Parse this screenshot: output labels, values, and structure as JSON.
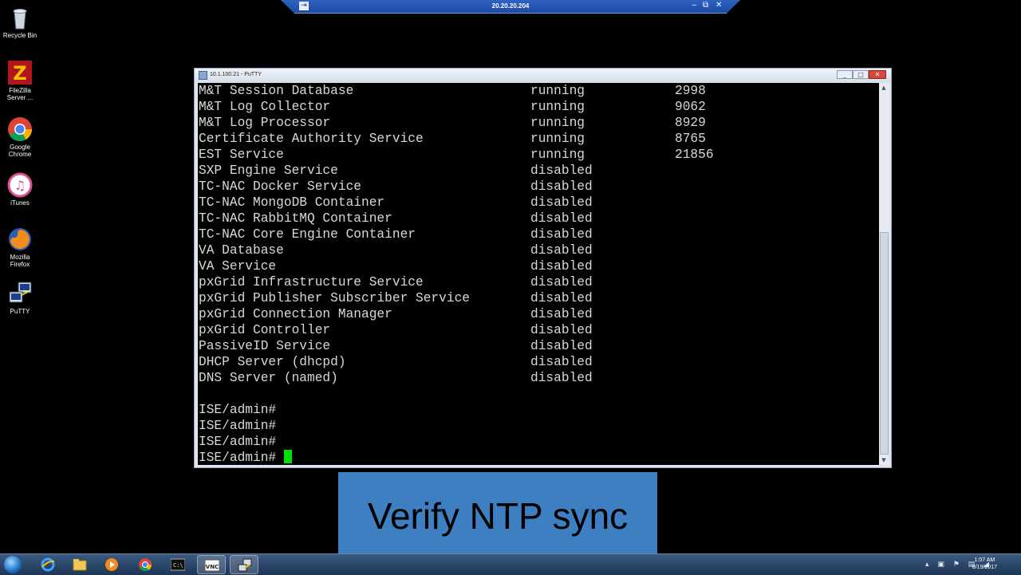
{
  "remote_bar": {
    "pin_icon": "⇥",
    "title": "20.20.20.204",
    "minimize": "‒",
    "restore": "⧉",
    "close": "✕"
  },
  "desktop_icons": [
    {
      "label": "Recycle Bin",
      "icon": "recycle-bin-icon"
    },
    {
      "label": "FileZilla Server ...",
      "icon": "filezilla-icon"
    },
    {
      "label": "Google Chrome",
      "icon": "chrome-icon"
    },
    {
      "label": "iTunes",
      "icon": "itunes-icon"
    },
    {
      "label": "Mozilla Firefox",
      "icon": "firefox-icon"
    },
    {
      "label": "PuTTY",
      "icon": "putty-icon"
    }
  ],
  "putty": {
    "title": "10.1.100.21 - PuTTY",
    "services": [
      {
        "name": "M&T Session Database",
        "status": "running",
        "pid": "2998"
      },
      {
        "name": "M&T Log Collector",
        "status": "running",
        "pid": "9062"
      },
      {
        "name": "M&T Log Processor",
        "status": "running",
        "pid": "8929"
      },
      {
        "name": "Certificate Authority Service",
        "status": "running",
        "pid": "8765"
      },
      {
        "name": "EST Service",
        "status": "running",
        "pid": "21856"
      },
      {
        "name": "SXP Engine Service",
        "status": "disabled",
        "pid": ""
      },
      {
        "name": "TC-NAC Docker Service",
        "status": "disabled",
        "pid": ""
      },
      {
        "name": "TC-NAC MongoDB Container",
        "status": "disabled",
        "pid": ""
      },
      {
        "name": "TC-NAC RabbitMQ Container",
        "status": "disabled",
        "pid": ""
      },
      {
        "name": "TC-NAC Core Engine Container",
        "status": "disabled",
        "pid": ""
      },
      {
        "name": "VA Database",
        "status": "disabled",
        "pid": ""
      },
      {
        "name": "VA Service",
        "status": "disabled",
        "pid": ""
      },
      {
        "name": "pxGrid Infrastructure Service",
        "status": "disabled",
        "pid": ""
      },
      {
        "name": "pxGrid Publisher Subscriber Service",
        "status": "disabled",
        "pid": ""
      },
      {
        "name": "pxGrid Connection Manager",
        "status": "disabled",
        "pid": ""
      },
      {
        "name": "pxGrid Controller",
        "status": "disabled",
        "pid": ""
      },
      {
        "name": "PassiveID Service",
        "status": "disabled",
        "pid": ""
      },
      {
        "name": "DHCP Server (dhcpd)",
        "status": "disabled",
        "pid": ""
      },
      {
        "name": "DNS Server (named)",
        "status": "disabled",
        "pid": ""
      }
    ],
    "prompts": [
      "ISE/admin#",
      "ISE/admin#",
      "ISE/admin#",
      "ISE/admin# "
    ]
  },
  "caption": "Verify NTP sync",
  "taskbar": {
    "apps": [
      "internet-explorer-icon",
      "file-explorer-icon",
      "media-player-icon",
      "chrome-icon",
      "cmd-icon",
      "vnc-icon",
      "putty-icon"
    ],
    "time": "1:07 AM",
    "date": "8/19/2017"
  }
}
